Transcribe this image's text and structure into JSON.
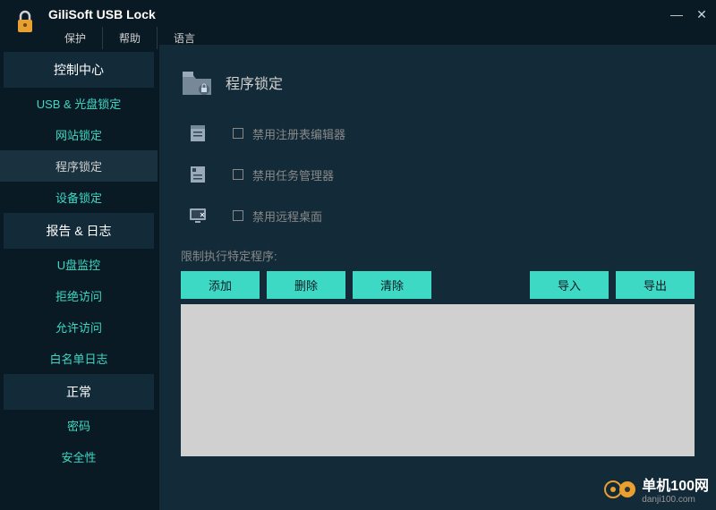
{
  "app": {
    "title": "GiliSoft USB Lock"
  },
  "menu": [
    "保护",
    "帮助",
    "语言"
  ],
  "sidebar": {
    "sections": [
      {
        "header": "控制中心",
        "items": [
          "USB & 光盘锁定",
          "网站锁定",
          "程序锁定",
          "设备锁定"
        ],
        "activeIndex": 2
      },
      {
        "header": "报告 & 日志",
        "items": [
          "U盘监控",
          "拒绝访问",
          "允许访问",
          "白名单日志"
        ],
        "activeIndex": -1
      },
      {
        "header": "正常",
        "items": [
          "密码",
          "安全性"
        ],
        "activeIndex": -1
      }
    ]
  },
  "page": {
    "title": "程序锁定",
    "options": [
      {
        "icon": "registry",
        "label": "禁用注册表编辑器"
      },
      {
        "icon": "taskmgr",
        "label": "禁用任务管理器"
      },
      {
        "icon": "remote",
        "label": "禁用远程桌面"
      }
    ],
    "restrictLabel": "限制执行特定程序:",
    "buttons": {
      "add": "添加",
      "delete": "删除",
      "clear": "清除",
      "import": "导入",
      "export": "导出"
    }
  },
  "watermark": {
    "main": "单机100网",
    "sub": "danji100.com"
  }
}
